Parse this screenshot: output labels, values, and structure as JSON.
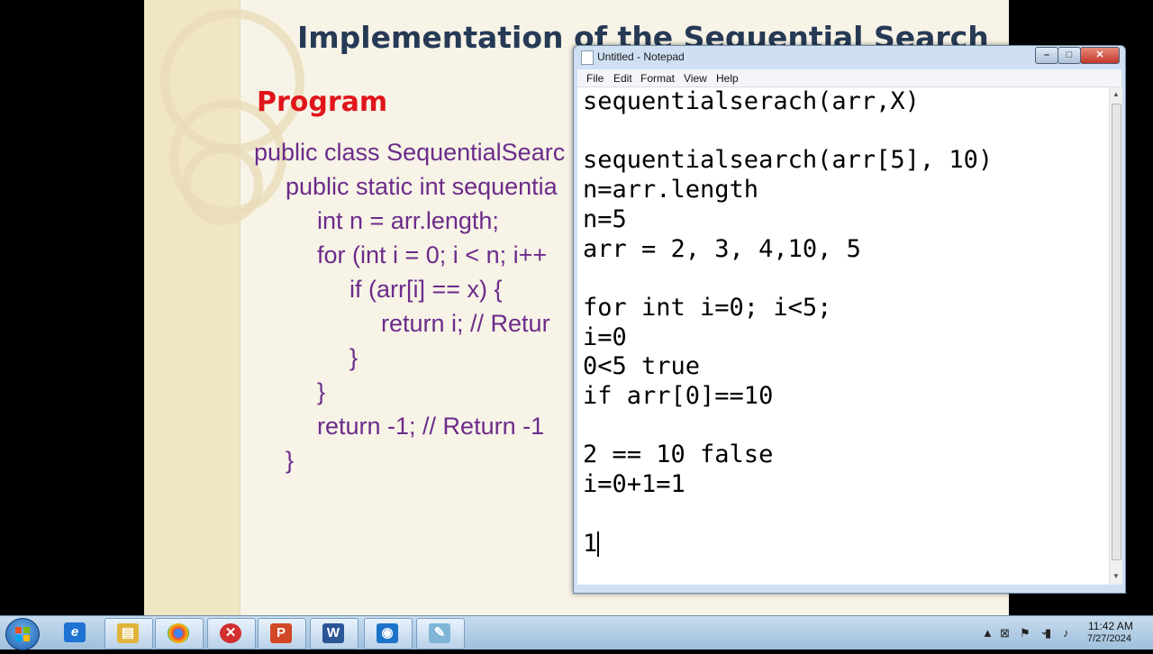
{
  "slide": {
    "title": "Implementation of the Sequential Search",
    "heading": "Program",
    "code_lines": [
      "public class SequentialSearc",
      "public static int sequentia",
      "int n = arr.length;",
      "for (int i = 0; i < n; i++",
      "if (arr[i] == x) {",
      "return i; // Retur",
      "}",
      "}",
      "return -1; // Return -1",
      "}"
    ]
  },
  "notepad": {
    "title": "Untitled - Notepad",
    "menu": [
      "File",
      "Edit",
      "Format",
      "View",
      "Help"
    ],
    "text": "sequentialserach(arr,X)\n\nsequentialsearch(arr[5], 10)\nn=arr.length\nn=5\narr = 2, 3, 4,10, 5\n\nfor int i=0; i<5;\ni=0\n0<5 true\nif arr[0]==10\n\n2 == 10 false\ni=0+1=1\n\n1"
  },
  "taskbar": {
    "apps": [
      {
        "name": "internet-explorer-icon",
        "glyph": "e",
        "color": "#1e73d2"
      },
      {
        "name": "file-explorer-icon",
        "glyph": "▤",
        "color": "#e0b43a"
      },
      {
        "name": "chrome-icon",
        "glyph": "●",
        "color": "#2b9a46"
      },
      {
        "name": "close-app-icon",
        "glyph": "✕",
        "color": "#d32f2f"
      },
      {
        "name": "powerpoint-icon",
        "glyph": "P",
        "color": "#d24726"
      },
      {
        "name": "word-icon",
        "glyph": "W",
        "color": "#2b5797"
      },
      {
        "name": "camera-app-icon",
        "glyph": "◉",
        "color": "#1d73c9"
      },
      {
        "name": "notepad-icon",
        "glyph": "✎",
        "color": "#7fb6d8"
      }
    ],
    "time": "11:42 AM",
    "date": "7/27/2024"
  },
  "colors": {
    "slide_title": "#263a56",
    "slide_heading": "#e0151b",
    "code": "#6b2b8b",
    "taskbar": "#b3cde6"
  }
}
